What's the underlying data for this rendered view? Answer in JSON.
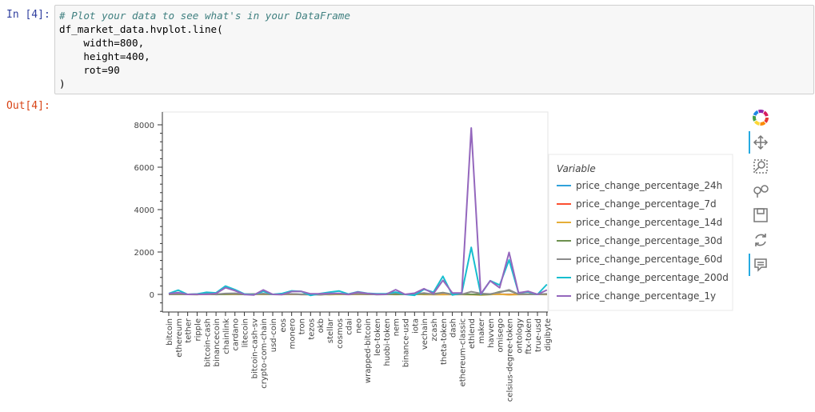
{
  "notebook": {
    "in_prompt": "In [4]:",
    "out_prompt": "Out[4]:",
    "code_lines": [
      "# Plot your data to see what's in your DataFrame",
      "df_market_data.hvplot.line(",
      "    width=800,",
      "    height=400,",
      "    rot=90",
      ")"
    ]
  },
  "toolbar": {
    "tools": [
      {
        "name": "bokeh-logo-icon",
        "active": false
      },
      {
        "name": "pan-icon",
        "active": true
      },
      {
        "name": "box-zoom-icon",
        "active": false
      },
      {
        "name": "wheel-zoom-icon",
        "active": false
      },
      {
        "name": "save-icon",
        "active": false
      },
      {
        "name": "reset-icon",
        "active": false
      },
      {
        "name": "hover-icon",
        "active": true
      }
    ]
  },
  "chart_data": {
    "type": "line",
    "title": "",
    "xlabel": "",
    "ylabel": "",
    "ylim": [
      -900,
      8400
    ],
    "yticks": [
      0,
      2000,
      4000,
      6000,
      8000
    ],
    "legend_title": "Variable",
    "legend_position": "right",
    "categories": [
      "bitcoin",
      "ethereum",
      "tether",
      "ripple",
      "bitcoin-cash",
      "binancecoin",
      "chainlink",
      "cardano",
      "litecoin",
      "bitcoin-cash-sv",
      "crypto-com-chain",
      "usd-coin",
      "eos",
      "monero",
      "tron",
      "tezos",
      "okb",
      "stellar",
      "cosmos",
      "cdai",
      "neo",
      "wrapped-bitcoin",
      "leo-token",
      "huobi-token",
      "nem",
      "binance-usd",
      "iota",
      "vechain",
      "zcash",
      "theta-token",
      "dash",
      "ethereum-classic",
      "ethlend",
      "maker",
      "havven",
      "omisego",
      "celsius-degree-token",
      "ontology",
      "ftx-token",
      "true-usd",
      "digibyte"
    ],
    "series": [
      {
        "name": "price_change_percentage_24h",
        "color": "#30a2da",
        "values": [
          1,
          8,
          0,
          -1,
          2,
          -1,
          1,
          3,
          -1,
          1,
          -1,
          0,
          0,
          -1,
          0,
          -1,
          2,
          1,
          0,
          -1,
          1,
          0,
          -1,
          -1,
          3,
          0,
          0,
          3,
          4,
          1,
          0,
          0,
          0,
          -1,
          10,
          2,
          3,
          0,
          0,
          0,
          1
        ]
      },
      {
        "name": "price_change_percentage_7d",
        "color": "#fc4f30",
        "values": [
          7,
          10,
          0,
          2,
          14,
          5,
          8,
          12,
          5,
          3,
          15,
          0,
          6,
          4,
          1,
          0,
          -3,
          5,
          10,
          -2,
          7,
          7,
          0,
          3,
          18,
          0,
          6,
          10,
          9,
          14,
          2,
          2,
          -3,
          10,
          7,
          10,
          -4,
          7,
          8,
          0,
          5
        ]
      },
      {
        "name": "price_change_percentage_14d",
        "color": "#e5ae38",
        "values": [
          6,
          12,
          0,
          -3,
          11,
          10,
          0,
          8,
          9,
          -1,
          5,
          0,
          -2,
          8,
          -4,
          -5,
          4,
          -10,
          5,
          1,
          2,
          3,
          1,
          4,
          -4,
          0,
          6,
          -4,
          -12,
          -7,
          -3,
          -3,
          -10,
          -28,
          -5,
          8,
          -20,
          -4,
          1,
          0,
          -4
        ]
      },
      {
        "name": "price_change_percentage_30d",
        "color": "#6d904f",
        "values": [
          7,
          14,
          0,
          -5,
          29,
          -2,
          13,
          29,
          -4,
          18,
          22,
          0,
          9,
          19,
          2,
          6,
          -15,
          11,
          22,
          0,
          27,
          7,
          4,
          4,
          3,
          0,
          13,
          26,
          22,
          88,
          1,
          3,
          2,
          -12,
          0,
          125,
          183,
          8,
          12,
          0,
          16
        ]
      },
      {
        "name": "price_change_percentage_60d",
        "color": "#8b8b8b",
        "values": [
          21,
          26,
          0,
          15,
          59,
          3,
          42,
          53,
          14,
          2,
          38,
          0,
          3,
          22,
          -4,
          -9,
          -12,
          15,
          41,
          -1,
          31,
          21,
          -6,
          0,
          72,
          0,
          6,
          63,
          0,
          76,
          -4,
          0,
          130,
          40,
          20,
          95,
          214,
          8,
          15,
          0,
          26
        ]
      },
      {
        "name": "price_change_percentage_200d",
        "color": "#17becf",
        "values": [
          43,
          200,
          1,
          20,
          97,
          71,
          392,
          227,
          20,
          -16,
          143,
          0,
          40,
          167,
          143,
          -50,
          39,
          106,
          162,
          16,
          125,
          52,
          27,
          34,
          110,
          0,
          -40,
          242,
          103,
          851,
          -29,
          74,
          2220,
          -3,
          644,
          443,
          1621,
          74,
          116,
          0,
          471
        ]
      },
      {
        "name": "price_change_percentage_1y",
        "color": "#9467bd",
        "values": [
          33,
          87,
          -0.5,
          4,
          3,
          42,
          316,
          178,
          -2,
          -25,
          211,
          0,
          -7,
          135,
          144,
          26,
          30,
          48,
          49,
          0,
          108,
          43,
          5,
          3,
          221,
          0,
          56,
          267,
          42,
          665,
          69,
          71,
          7850,
          18,
          638,
          314,
          1982,
          72,
          147,
          0,
          209
        ]
      }
    ]
  }
}
